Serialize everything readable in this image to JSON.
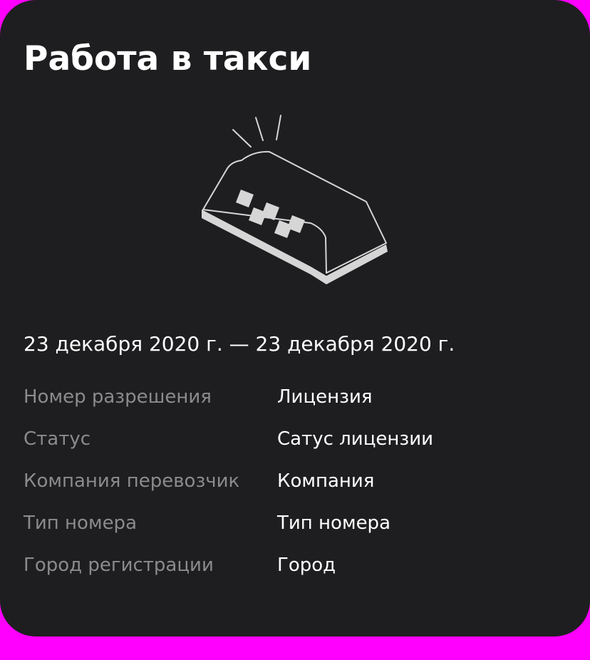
{
  "card": {
    "title": "Работа в такси",
    "illustration_icon": "taxi-roof-sign-icon",
    "date_range": "23 декабря 2020 г. — 23 декабря 2020 г.",
    "details": [
      {
        "label": "Номер разрешения",
        "value": "Лицензия"
      },
      {
        "label": "Статус",
        "value": "Сатус лицензии"
      },
      {
        "label": "Компания перевозчик",
        "value": "Компания"
      },
      {
        "label": "Тип номера",
        "value": "Тип номера"
      },
      {
        "label": "Город регистрации",
        "value": "Город"
      }
    ]
  },
  "colors": {
    "background": "#ff00ff",
    "card": "#1e1e20",
    "primary_text": "#ffffff",
    "secondary_text": "#8b8b8e",
    "illustration": "#d6d6d6"
  }
}
